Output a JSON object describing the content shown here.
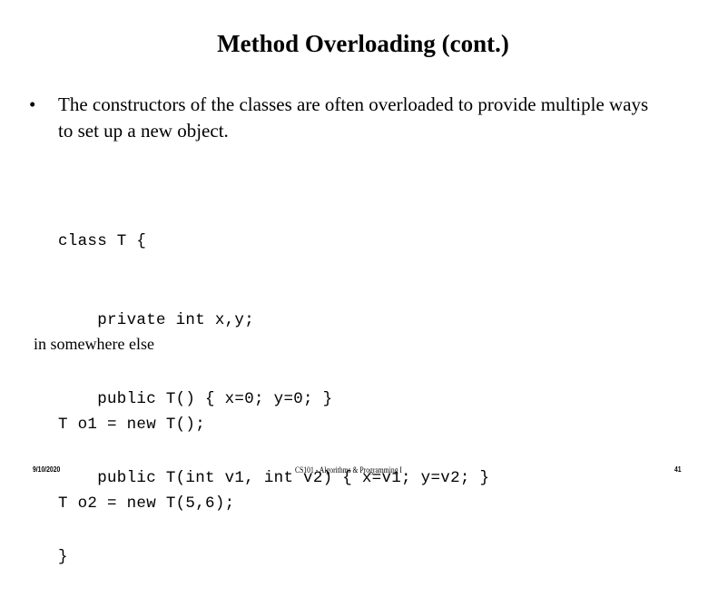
{
  "slide": {
    "title": "Method Overloading (cont.)",
    "bullet": {
      "marker": "•",
      "text": "The constructors of the classes are often overloaded to provide multiple ways to set up a new object."
    },
    "code_class": [
      "class T {",
      "    private int x,y;",
      "    public T() { x=0; y=0; }",
      "    public T(int v1, int v2) { x=v1; y=v2; }",
      "}"
    ],
    "usage_label": "in somewhere else",
    "code_usage": [
      "T o1 = new T();",
      "T o2 = new T(5,6);"
    ]
  },
  "footer": {
    "date": "9/10/2020",
    "course": "CS101 - Algorithms & Programming I",
    "page": "41"
  }
}
